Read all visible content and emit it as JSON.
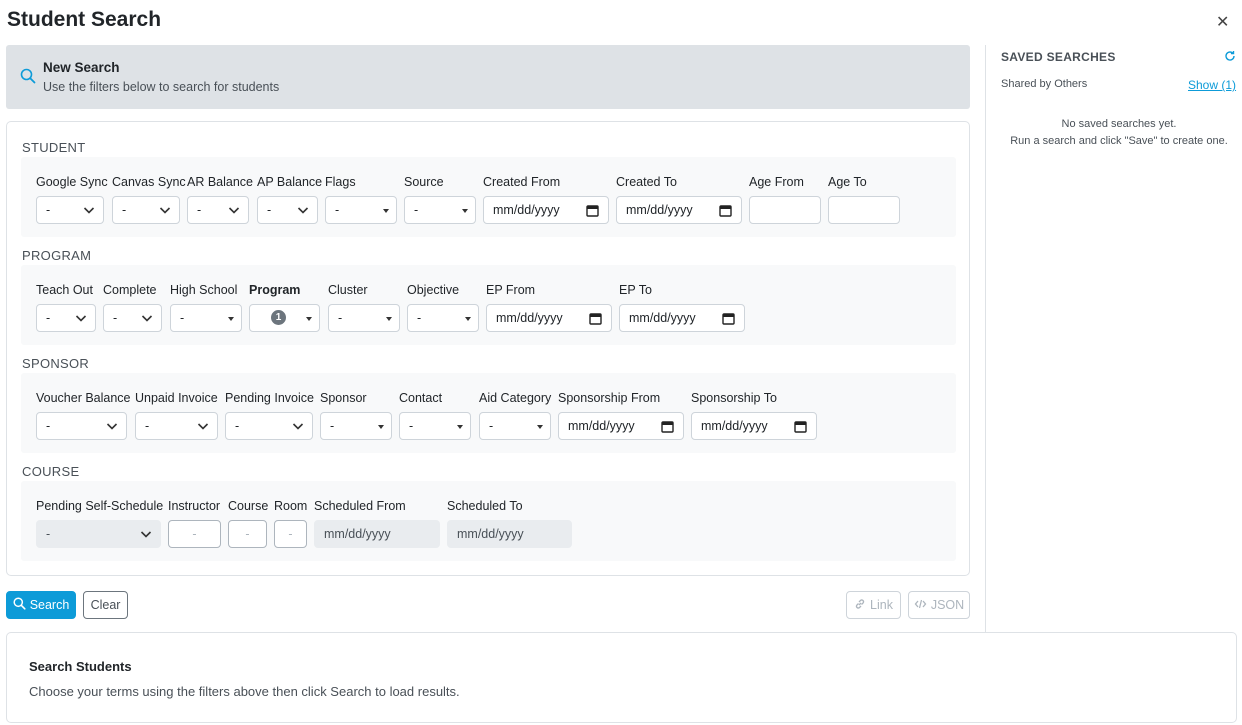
{
  "title": "Student Search",
  "banner": {
    "title": "New Search",
    "subtitle": "Use the filters below to search for students"
  },
  "sections": {
    "student": {
      "heading": "STUDENT",
      "fields": {
        "google_sync": {
          "label": "Google Sync",
          "value": "-"
        },
        "canvas_sync": {
          "label": "Canvas Sync",
          "value": "-"
        },
        "ar_balance": {
          "label": "AR Balance",
          "value": "-"
        },
        "ap_balance": {
          "label": "AP Balance",
          "value": "-"
        },
        "flags": {
          "label": "Flags",
          "value": "-"
        },
        "source": {
          "label": "Source",
          "value": "-"
        },
        "created_from": {
          "label": "Created From",
          "value": "mm/dd/yyyy"
        },
        "created_to": {
          "label": "Created To",
          "value": "mm/dd/yyyy"
        },
        "age_from": {
          "label": "Age From",
          "value": ""
        },
        "age_to": {
          "label": "Age To",
          "value": ""
        }
      }
    },
    "program": {
      "heading": "PROGRAM",
      "fields": {
        "teach_out": {
          "label": "Teach Out",
          "value": "-"
        },
        "complete": {
          "label": "Complete",
          "value": "-"
        },
        "high_school": {
          "label": "High School",
          "value": "-"
        },
        "program": {
          "label": "Program",
          "badge": "1"
        },
        "cluster": {
          "label": "Cluster",
          "value": "-"
        },
        "objective": {
          "label": "Objective",
          "value": "-"
        },
        "ep_from": {
          "label": "EP From",
          "value": "mm/dd/yyyy"
        },
        "ep_to": {
          "label": "EP To",
          "value": "mm/dd/yyyy"
        }
      }
    },
    "sponsor": {
      "heading": "SPONSOR",
      "fields": {
        "voucher_balance": {
          "label": "Voucher Balance",
          "value": "-"
        },
        "unpaid_invoice": {
          "label": "Unpaid Invoice",
          "value": "-"
        },
        "pending_invoice": {
          "label": "Pending Invoice",
          "value": "-"
        },
        "sponsor": {
          "label": "Sponsor",
          "value": "-"
        },
        "contact": {
          "label": "Contact",
          "value": "-"
        },
        "aid_category": {
          "label": "Aid Category",
          "value": "-"
        },
        "sponsorship_from": {
          "label": "Sponsorship From",
          "value": "mm/dd/yyyy"
        },
        "sponsorship_to": {
          "label": "Sponsorship To",
          "value": "mm/dd/yyyy"
        }
      }
    },
    "course": {
      "heading": "COURSE",
      "fields": {
        "pending_self_schedule": {
          "label": "Pending Self-Schedule",
          "value": "-"
        },
        "instructor": {
          "label": "Instructor",
          "value": "-"
        },
        "course": {
          "label": "Course",
          "value": "-"
        },
        "room": {
          "label": "Room",
          "value": "-"
        },
        "scheduled_from": {
          "label": "Scheduled From",
          "value": "mm/dd/yyyy"
        },
        "scheduled_to": {
          "label": "Scheduled To",
          "value": "mm/dd/yyyy"
        }
      }
    }
  },
  "buttons": {
    "search": "Search",
    "clear": "Clear",
    "link": "Link",
    "json": "JSON"
  },
  "sidebar": {
    "title": "SAVED SEARCHES",
    "shared_label": "Shared by Others",
    "show_link": "Show (1)",
    "empty_line1": "No saved searches yet.",
    "empty_line2": "Run a search and click \"Save\" to create one."
  },
  "results": {
    "title": "Search Students",
    "text": "Choose your terms using the filters above then click Search to load results."
  },
  "colors": {
    "accent": "#0d9bd8",
    "banner_bg": "#dee2e6",
    "section_bg": "#f8f9fa"
  }
}
